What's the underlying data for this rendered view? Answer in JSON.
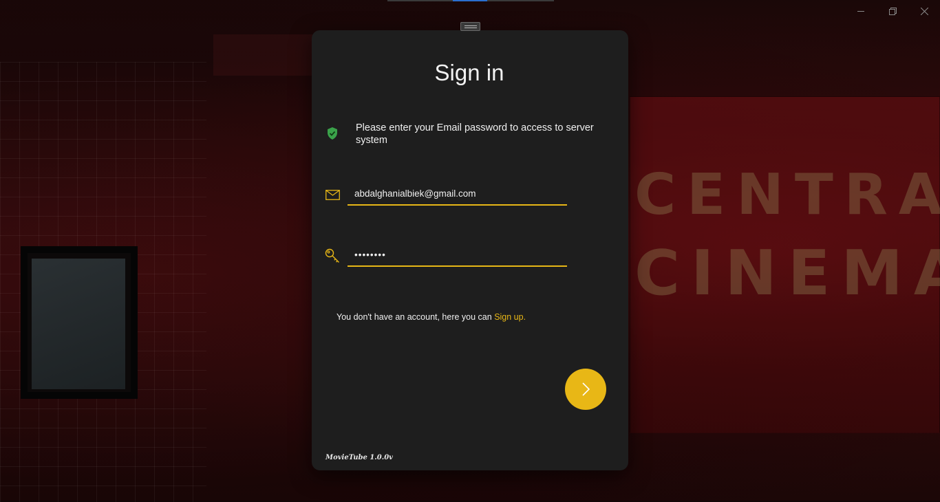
{
  "window": {
    "controls": [
      "minimize",
      "restore",
      "close"
    ]
  },
  "background": {
    "sign_line1": "CENTRAL",
    "sign_line2": "CINEMA"
  },
  "signin": {
    "title": "Sign in",
    "notice": "Please enter your Email password to access to server system",
    "email_value": "abdalghanialbiek@gmail.com",
    "password_value": "••••••••",
    "signup_prompt": "You don't have an account, here you can ",
    "signup_link": "Sign up.",
    "version": "MovieTube 1.0.0v"
  },
  "colors": {
    "accent": "#e8b716",
    "card": "#1e1e1e",
    "shield": "#3aa24a"
  },
  "icons": {
    "notice": "shield-check-icon",
    "email": "mail-icon",
    "password": "key-icon",
    "submit": "chevron-right-icon"
  }
}
